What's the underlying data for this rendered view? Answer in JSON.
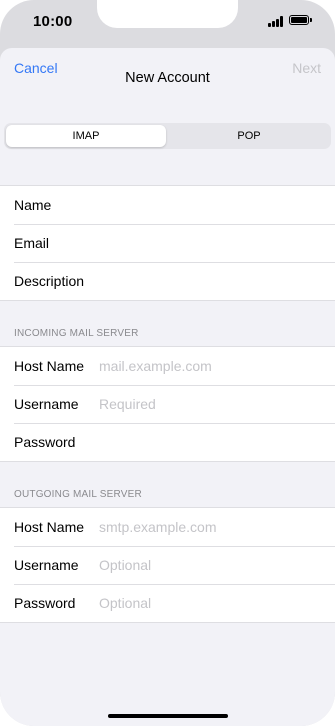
{
  "status_bar": {
    "time": "10:00",
    "signal_icon": "cellular-signal-icon",
    "battery_icon": "battery-icon"
  },
  "nav": {
    "cancel_label": "Cancel",
    "title": "New Account",
    "next_label": "Next"
  },
  "segmented": {
    "options": [
      "IMAP",
      "POP"
    ],
    "selected": "IMAP"
  },
  "account_fields": {
    "name_label": "Name",
    "email_label": "Email",
    "description_label": "Description"
  },
  "incoming": {
    "header": "INCOMING MAIL SERVER",
    "host_label": "Host Name",
    "host_placeholder": "mail.example.com",
    "username_label": "Username",
    "username_placeholder": "Required",
    "password_label": "Password",
    "password_placeholder": ""
  },
  "outgoing": {
    "header": "OUTGOING MAIL SERVER",
    "host_label": "Host Name",
    "host_placeholder": "smtp.example.com",
    "username_label": "Username",
    "username_placeholder": "Optional",
    "password_label": "Password",
    "password_placeholder": "Optional"
  },
  "colors": {
    "accent": "#3478f6",
    "disabled": "#c5c5c9",
    "background": "#f2f2f7",
    "placeholder": "#c4c4c8"
  }
}
